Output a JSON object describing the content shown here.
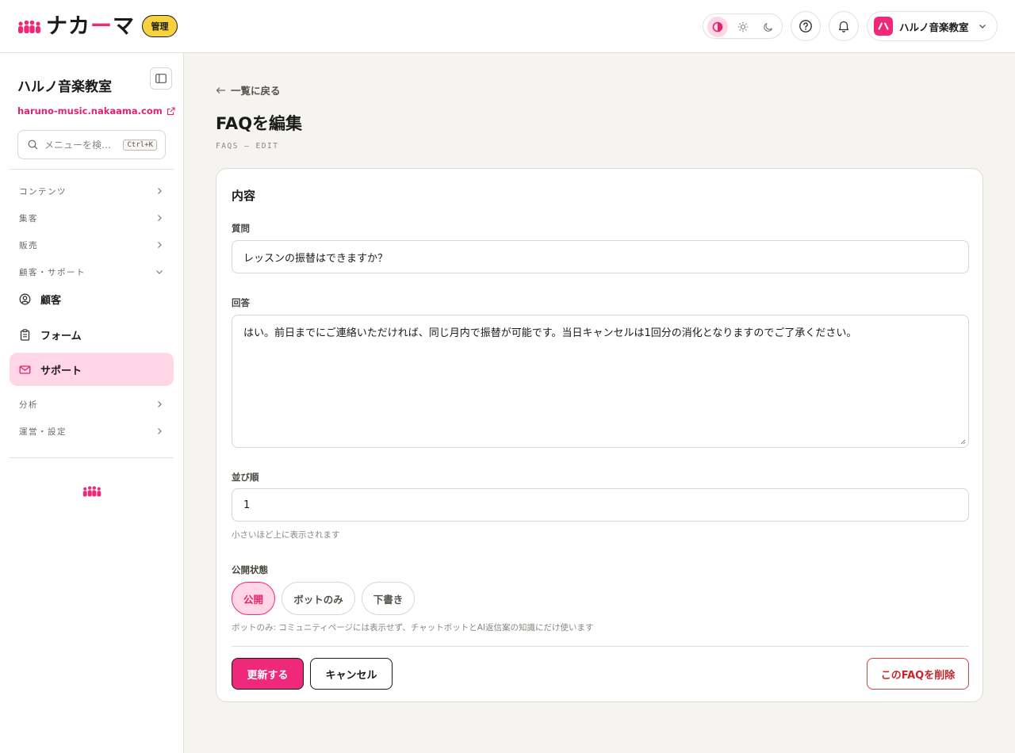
{
  "brand": {
    "logo_text": "ナカ",
    "logo_dash": "ー",
    "logo_tail": "マ",
    "admin_badge": "管理",
    "accent": "#f0287a"
  },
  "header": {
    "account_name": "ハルノ音楽教室",
    "account_avatar": "ハ",
    "theme_options": [
      "contrast-icon",
      "sun-icon",
      "moon-icon"
    ],
    "theme_selected": "contrast-icon"
  },
  "sidebar": {
    "title": "ハルノ音楽教室",
    "url": "haruno-music.nakaama.com",
    "search_placeholder": "メニューを検…",
    "search_shortcut": "Ctrl+K",
    "groups": {
      "content": "コンテンツ",
      "marketing": "集客",
      "sales": "販売",
      "support_group": "顧客・サポート",
      "analytics": "分析",
      "settings": "運営・設定"
    },
    "items": {
      "customers": "顧客",
      "forms": "フォーム",
      "support": "サポート"
    },
    "active_item": "support"
  },
  "page": {
    "back_link": "一覧に戻る",
    "title": "FAQを編集",
    "subtitle": "FAQS — EDIT"
  },
  "form": {
    "section_title": "内容",
    "question_label": "質問",
    "question_value": "レッスンの振替はできますか？",
    "answer_label": "回答",
    "answer_value": "はい。前日までにご連絡いただければ、同じ月内で振替が可能です。当日キャンセルは1回分の消化となりますのでご了承ください。",
    "order_label": "並び順",
    "order_value": "1",
    "order_help": "小さいほど上に表示されます",
    "visibility_label": "公開状態",
    "visibility_options": {
      "public": "公開",
      "bot_only": "ボットのみ",
      "draft": "下書き"
    },
    "visibility_selected": "public",
    "visibility_help": "ボットのみ: コミュニティページには表示せず、チャットボットとAI返信案の知識にだけ使います",
    "update_button": "更新する",
    "cancel_button": "キャンセル",
    "delete_button": "このFAQを削除"
  }
}
